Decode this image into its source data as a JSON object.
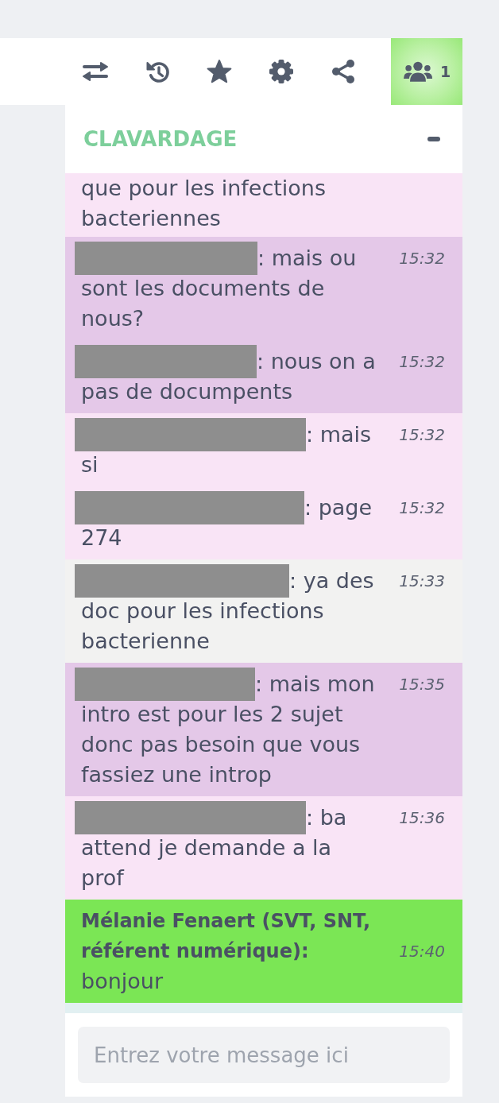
{
  "toolbar": {
    "participants": {
      "count": "1",
      "selected": true
    }
  },
  "chat": {
    "title": "CLAVARDAGE",
    "messages": [
      {
        "text": "que pour les infections bacteriennes",
        "color": "#f9e4f6"
      },
      {
        "sender_redacted": true,
        "text": ": mais ou sont les documents de nous?",
        "time": "15:32",
        "color": "#e4c8e8"
      },
      {
        "sender_redacted": true,
        "text": ": nous on a pas de documpents",
        "time": "15:32",
        "color": "#e4c8e8"
      },
      {
        "sender_redacted": true,
        "text": ": mais si",
        "time": "15:32",
        "color": "#f9e4f6"
      },
      {
        "sender_redacted": true,
        "text": ": page 274",
        "time": "15:32",
        "color": "#f9e4f6"
      },
      {
        "sender_redacted": true,
        "text": ": ya des doc pour les infections bacterienne",
        "time": "15:33",
        "color": "#f2f2f1"
      },
      {
        "sender_redacted": true,
        "text": ": mais mon intro est pour les 2 sujet donc pas besoin que vous fassiez une introp",
        "time": "15:35",
        "color": "#e4c8e8"
      },
      {
        "sender_redacted": true,
        "text": ": ba attend je demande a la prof",
        "time": "15:36",
        "color": "#f9e4f6"
      },
      {
        "sender_redacted": false,
        "sender": "Mélanie Fenaert (SVT, SNT, référent numérique):",
        "text": "bonjour",
        "time": "15:40",
        "color": "#7be655"
      }
    ],
    "input": {
      "placeholder": "Entrez votre message ici"
    }
  }
}
